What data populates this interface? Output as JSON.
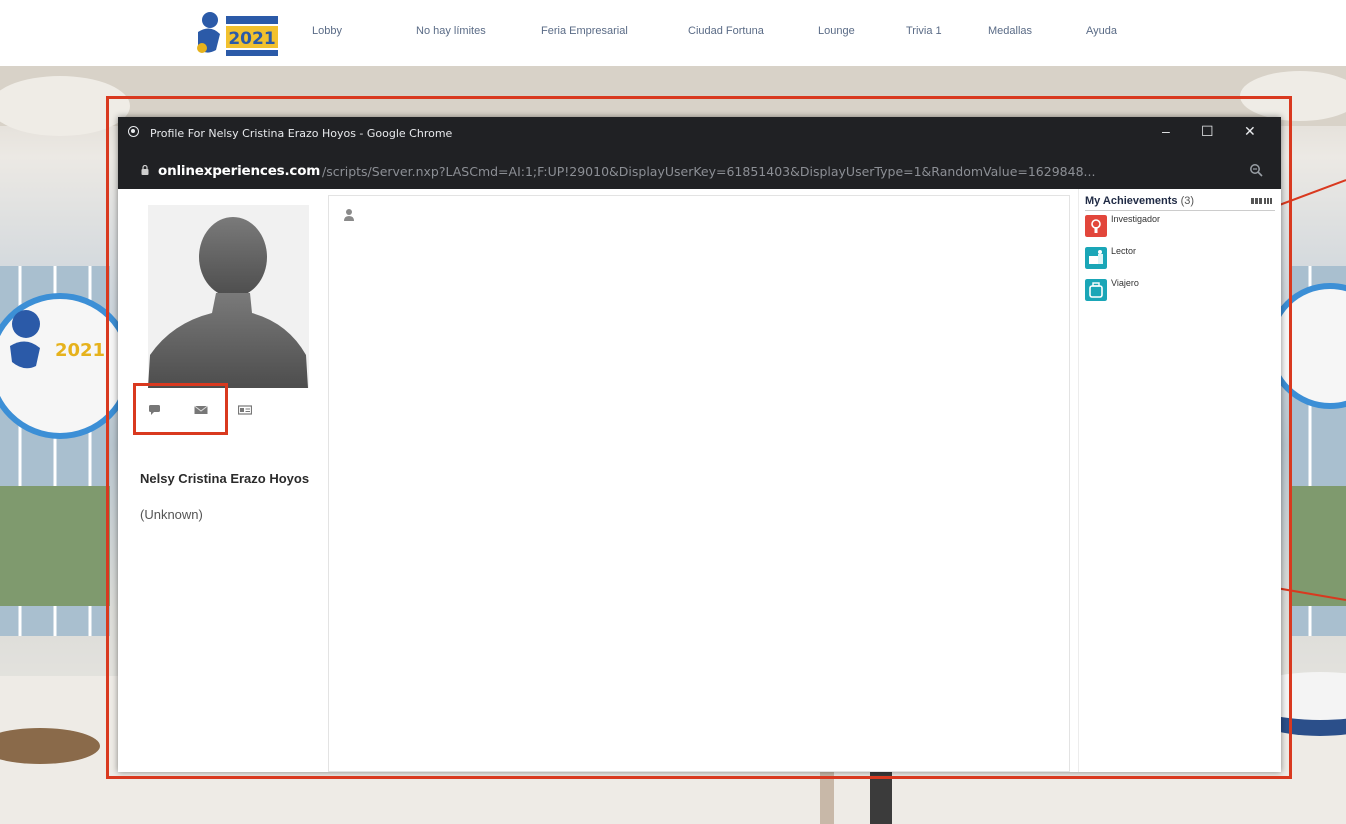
{
  "site_nav": {
    "items": [
      {
        "label": "Lobby"
      },
      {
        "label": "No hay límites"
      },
      {
        "label": "Feria Empresarial"
      },
      {
        "label": "Ciudad Fortuna"
      },
      {
        "label": "Lounge"
      },
      {
        "label": "Trivia 1"
      },
      {
        "label": "Medallas"
      },
      {
        "label": "Ayuda"
      }
    ],
    "logo_text": "2021"
  },
  "popup": {
    "window_title": "Profile For Nelsy Cristina Erazo Hoyos - Google Chrome",
    "url_host": "onlinexperiences.com",
    "url_path": "/scripts/Server.nxp?LASCmd=AI:1;F:UP!29010&DisplayUserKey=61851403&DisplayUserType=1&RandomValue=1629848...",
    "minimize_symbol": "–",
    "maximize_symbol": "☐",
    "close_symbol": "✕"
  },
  "profile": {
    "name": "Nelsy Cristina Erazo Hoyos",
    "status": "(Unknown)",
    "actions": [
      "chat-icon",
      "mail-icon",
      "business-card-icon"
    ]
  },
  "achievements": {
    "title": "My Achievements",
    "count": "(3)",
    "items": [
      {
        "label": "Investigador",
        "icon": "researcher-badge-icon",
        "color": "#e2463b"
      },
      {
        "label": "Lector",
        "icon": "reader-badge-icon",
        "color": "#1aa6b7"
      },
      {
        "label": "Viajero",
        "icon": "traveler-badge-icon",
        "color": "#1aa6b7"
      }
    ]
  },
  "colors": {
    "highlight": "#d9391f",
    "chrome_bar": "#202124",
    "nav_text": "#5a6b86"
  }
}
